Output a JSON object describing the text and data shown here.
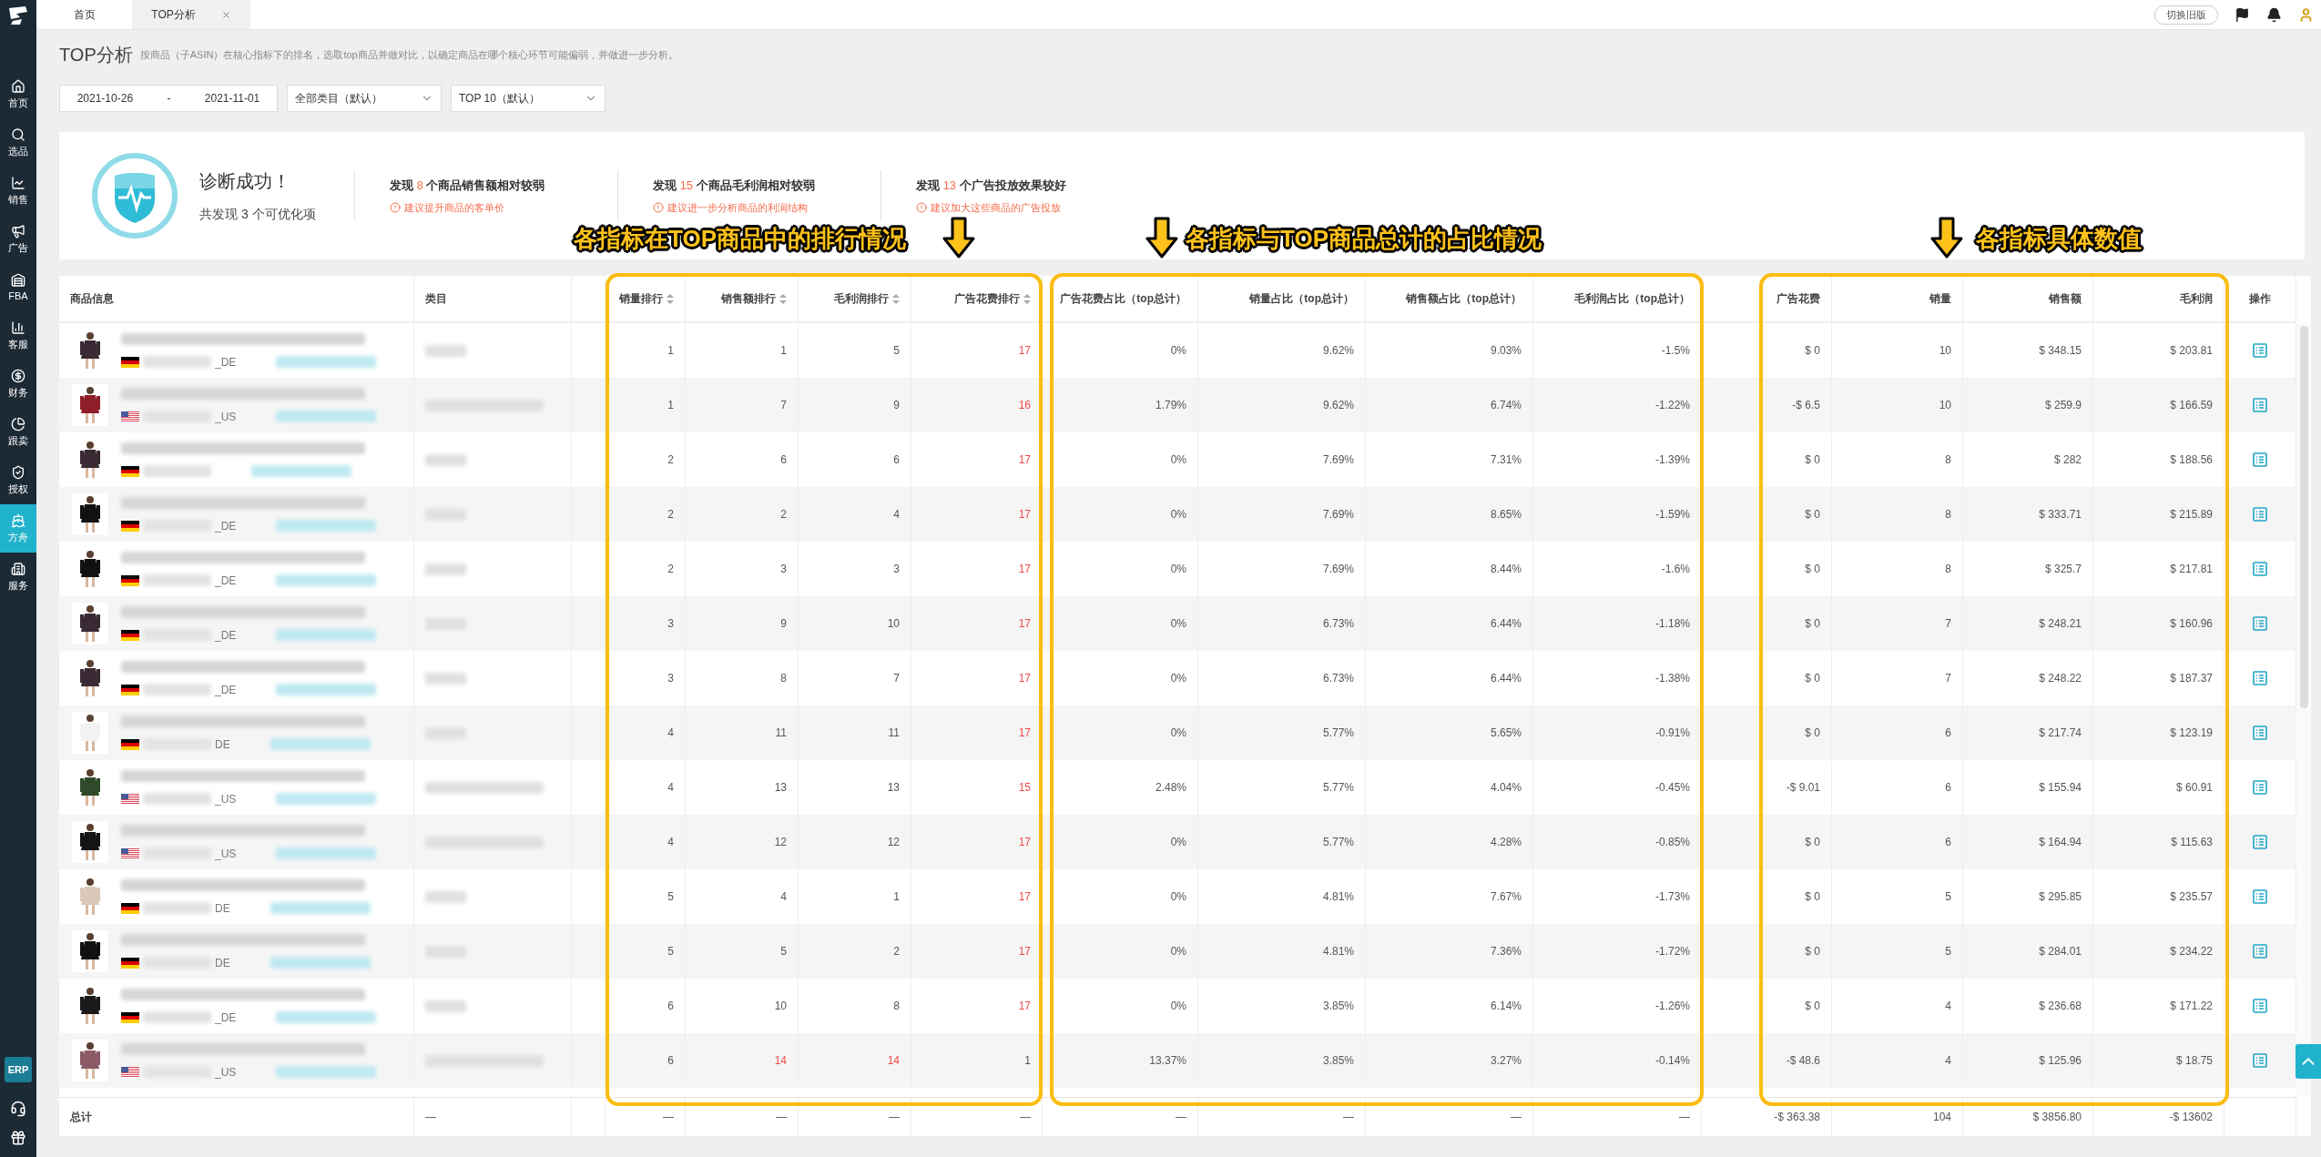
{
  "sidebar": {
    "items": [
      {
        "label": "首页",
        "selected": false
      },
      {
        "label": "选品",
        "selected": false
      },
      {
        "label": "销售",
        "selected": false
      },
      {
        "label": "广告",
        "selected": false
      },
      {
        "label": "FBA",
        "selected": false
      },
      {
        "label": "客服",
        "selected": false
      },
      {
        "label": "财务",
        "selected": false
      },
      {
        "label": "跟卖",
        "selected": false
      },
      {
        "label": "授权",
        "selected": false
      },
      {
        "label": "方舟",
        "selected": true
      },
      {
        "label": "服务",
        "selected": false
      }
    ],
    "badge": "ERP"
  },
  "tabs": [
    {
      "label": "首页",
      "selected": false,
      "closable": false
    },
    {
      "label": "TOP分析",
      "selected": true,
      "closable": true
    }
  ],
  "header": {
    "switch_button": "切换旧版"
  },
  "page": {
    "title": "TOP分析",
    "description": "按商品（子ASIN）在核心指标下的排名，选取top商品并做对比，以确定商品在哪个核心环节可能偏弱，并做进一步分析。"
  },
  "filters": {
    "date_start": "2021-10-26",
    "date_separator": "-",
    "date_end": "2021-11-01",
    "category": "全部类目（默认）",
    "top": "TOP 10（默认）"
  },
  "diagnosis": {
    "title": "诊断成功！",
    "summary": "共发现 3 个可优化项",
    "findings": [
      {
        "prefix": "发现",
        "count": "8",
        "suffix": "个商品销售额相对较弱",
        "advice": "建议提升商品的客单价"
      },
      {
        "prefix": "发现",
        "count": "15",
        "suffix": "个商品毛利润相对较弱",
        "advice": "建议进一步分析商品的利润结构"
      },
      {
        "prefix": "发现",
        "count": "13",
        "suffix": "个广告投放效果较好",
        "advice": "建议加大这些商品的广告投放"
      }
    ]
  },
  "annotations": [
    {
      "text": "各指标在TOP商品中的排行情况"
    },
    {
      "text": "各指标与TOP商品总计的占比情况"
    },
    {
      "text": "各指标具体数值"
    }
  ],
  "table": {
    "columns": [
      {
        "label": "商品信息",
        "sortable": false
      },
      {
        "label": "类目",
        "sortable": false
      },
      {
        "label": "销量排行",
        "sortable": true
      },
      {
        "label": "销售额排行",
        "sortable": true
      },
      {
        "label": "毛利润排行",
        "sortable": true
      },
      {
        "label": "广告花费排行",
        "sortable": true
      },
      {
        "label": "广告花费占比（top总计）",
        "sortable": false
      },
      {
        "label": "销量占比（top总计）",
        "sortable": false
      },
      {
        "label": "销售额占比（top总计）",
        "sortable": false
      },
      {
        "label": "毛利润占比（top总计）",
        "sortable": false
      },
      {
        "label": "广告花费",
        "sortable": false
      },
      {
        "label": "销量",
        "sortable": false
      },
      {
        "label": "销售额",
        "sortable": false
      },
      {
        "label": "毛利润",
        "sortable": false
      },
      {
        "label": "操作",
        "sortable": false
      }
    ],
    "rows": [
      {
        "flag": {
          "kind": "de"
        },
        "market": "_DE",
        "ranks": [
          {
            "value": "1",
            "warn": false
          },
          {
            "value": "1",
            "warn": false
          },
          {
            "value": "5",
            "warn": false
          },
          {
            "value": "17",
            "warn": true
          }
        ],
        "ratios": [
          "0%",
          "9.62%",
          "9.03%",
          "-1.5%"
        ],
        "values": [
          "$ 0",
          "10",
          "$ 348.15",
          "$ 203.81"
        ]
      },
      {
        "flag": {
          "kind": "us"
        },
        "market": "_US",
        "ranks": [
          {
            "value": "1",
            "warn": false
          },
          {
            "value": "7",
            "warn": false
          },
          {
            "value": "9",
            "warn": false
          },
          {
            "value": "16",
            "warn": true
          }
        ],
        "ratios": [
          "1.79%",
          "9.62%",
          "6.74%",
          "-1.22%"
        ],
        "values": [
          "-$ 6.5",
          "10",
          "$ 259.9",
          "$ 166.59"
        ]
      },
      {
        "flag": {
          "kind": "de"
        },
        "ranks": [
          {
            "value": "2",
            "warn": false
          },
          {
            "value": "6",
            "warn": false
          },
          {
            "value": "6",
            "warn": false
          },
          {
            "value": "17",
            "warn": true
          }
        ],
        "ratios": [
          "0%",
          "7.69%",
          "7.31%",
          "-1.39%"
        ],
        "values": [
          "$ 0",
          "8",
          "$ 282",
          "$ 188.56"
        ]
      },
      {
        "flag": {
          "kind": "de"
        },
        "market": "_DE",
        "ranks": [
          {
            "value": "2",
            "warn": false
          },
          {
            "value": "2",
            "warn": false
          },
          {
            "value": "4",
            "warn": false
          },
          {
            "value": "17",
            "warn": true
          }
        ],
        "ratios": [
          "0%",
          "7.69%",
          "8.65%",
          "-1.59%"
        ],
        "values": [
          "$ 0",
          "8",
          "$ 333.71",
          "$ 215.89"
        ]
      },
      {
        "flag": {
          "kind": "de"
        },
        "market": "_DE",
        "ranks": [
          {
            "value": "2",
            "warn": false
          },
          {
            "value": "3",
            "warn": false
          },
          {
            "value": "3",
            "warn": false
          },
          {
            "value": "17",
            "warn": true
          }
        ],
        "ratios": [
          "0%",
          "7.69%",
          "8.44%",
          "-1.6%"
        ],
        "values": [
          "$ 0",
          "8",
          "$ 325.7",
          "$ 217.81"
        ]
      },
      {
        "flag": {
          "kind": "de"
        },
        "market": "_DE",
        "ranks": [
          {
            "value": "3",
            "warn": false
          },
          {
            "value": "9",
            "warn": false
          },
          {
            "value": "10",
            "warn": false
          },
          {
            "value": "17",
            "warn": true
          }
        ],
        "ratios": [
          "0%",
          "6.73%",
          "6.44%",
          "-1.18%"
        ],
        "values": [
          "$ 0",
          "7",
          "$ 248.21",
          "$ 160.96"
        ]
      },
      {
        "flag": {
          "kind": "de"
        },
        "market": "_DE",
        "ranks": [
          {
            "value": "3",
            "warn": false
          },
          {
            "value": "8",
            "warn": false
          },
          {
            "value": "7",
            "warn": false
          },
          {
            "value": "17",
            "warn": true
          }
        ],
        "ratios": [
          "0%",
          "6.73%",
          "6.44%",
          "-1.38%"
        ],
        "values": [
          "$ 0",
          "7",
          "$ 248.22",
          "$ 187.37"
        ]
      },
      {
        "flag": {
          "kind": "de"
        },
        "market": "DE",
        "ranks": [
          {
            "value": "4",
            "warn": false
          },
          {
            "value": "11",
            "warn": false
          },
          {
            "value": "11",
            "warn": false
          },
          {
            "value": "17",
            "warn": true
          }
        ],
        "ratios": [
          "0%",
          "5.77%",
          "5.65%",
          "-0.91%"
        ],
        "values": [
          "$ 0",
          "6",
          "$ 217.74",
          "$ 123.19"
        ]
      },
      {
        "flag": {
          "kind": "us"
        },
        "market": "_US",
        "ranks": [
          {
            "value": "4",
            "warn": false
          },
          {
            "value": "13",
            "warn": false
          },
          {
            "value": "13",
            "warn": false
          },
          {
            "value": "15",
            "warn": true
          }
        ],
        "ratios": [
          "2.48%",
          "5.77%",
          "4.04%",
          "-0.45%"
        ],
        "values": [
          "-$ 9.01",
          "6",
          "$ 155.94",
          "$ 60.91"
        ]
      },
      {
        "flag": {
          "kind": "us"
        },
        "market": "_US",
        "ranks": [
          {
            "value": "4",
            "warn": false
          },
          {
            "value": "12",
            "warn": false
          },
          {
            "value": "12",
            "warn": false
          },
          {
            "value": "17",
            "warn": true
          }
        ],
        "ratios": [
          "0%",
          "5.77%",
          "4.28%",
          "-0.85%"
        ],
        "values": [
          "$ 0",
          "6",
          "$ 164.94",
          "$ 115.63"
        ]
      },
      {
        "flag": {
          "kind": "de"
        },
        "market": "DE",
        "ranks": [
          {
            "value": "5",
            "warn": false
          },
          {
            "value": "4",
            "warn": false
          },
          {
            "value": "1",
            "warn": false
          },
          {
            "value": "17",
            "warn": true
          }
        ],
        "ratios": [
          "0%",
          "4.81%",
          "7.67%",
          "-1.73%"
        ],
        "values": [
          "$ 0",
          "5",
          "$ 295.85",
          "$ 235.57"
        ]
      },
      {
        "flag": {
          "kind": "de"
        },
        "market": "DE",
        "ranks": [
          {
            "value": "5",
            "warn": false
          },
          {
            "value": "5",
            "warn": false
          },
          {
            "value": "2",
            "warn": false
          },
          {
            "value": "17",
            "warn": true
          }
        ],
        "ratios": [
          "0%",
          "4.81%",
          "7.36%",
          "-1.72%"
        ],
        "values": [
          "$ 0",
          "5",
          "$ 284.01",
          "$ 234.22"
        ]
      },
      {
        "flag": {
          "kind": "de"
        },
        "market": "_DE",
        "ranks": [
          {
            "value": "6",
            "warn": false
          },
          {
            "value": "10",
            "warn": false
          },
          {
            "value": "8",
            "warn": false
          },
          {
            "value": "17",
            "warn": true
          }
        ],
        "ratios": [
          "0%",
          "3.85%",
          "6.14%",
          "-1.26%"
        ],
        "values": [
          "$ 0",
          "4",
          "$ 236.68",
          "$ 171.22"
        ]
      },
      {
        "flag": {
          "kind": "us"
        },
        "market": "_US",
        "ranks": [
          {
            "value": "6",
            "warn": false
          },
          {
            "value": "14",
            "warn": true
          },
          {
            "value": "14",
            "warn": true
          },
          {
            "value": "1",
            "warn": false
          }
        ],
        "ratios": [
          "13.37%",
          "3.85%",
          "3.27%",
          "-0.14%"
        ],
        "values": [
          "-$ 48.6",
          "4",
          "$ 125.96",
          "$ 18.75"
        ]
      }
    ],
    "total": {
      "label": "总计",
      "category": "—",
      "ranks": [
        "—",
        "—",
        "—",
        "—"
      ],
      "ratios": [
        "—",
        "—",
        "—",
        "—"
      ],
      "values": [
        "-$ 363.38",
        "104",
        "$ 3856.80",
        "-$ 13602"
      ]
    }
  }
}
